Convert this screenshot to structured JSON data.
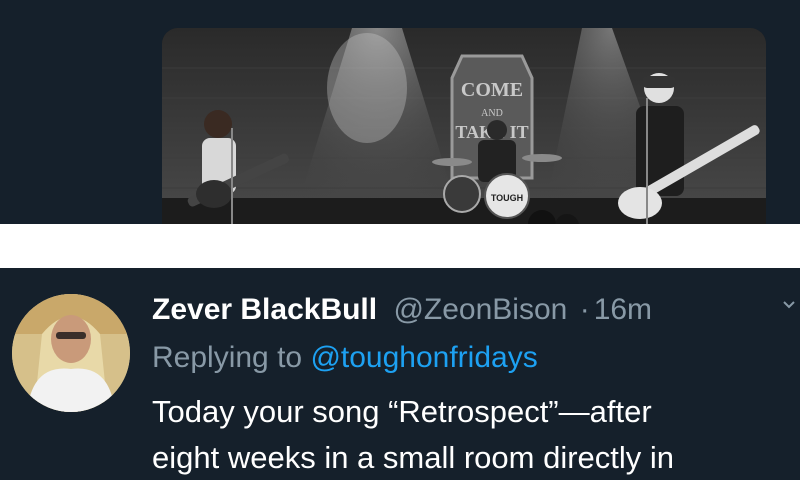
{
  "reply_tweet": {
    "display_name": "Zever BlackBull",
    "handle": "@ZeonBison",
    "separator": "·",
    "time": "16m",
    "replying_prefix": "Replying to",
    "replying_to": "@toughonfridays",
    "text_line_1": "Today your song “Retrospect”—after",
    "text_line_2": "eight weeks in a small room directly in"
  },
  "media": {
    "sign_text_1": "COME",
    "sign_text_2": "AND",
    "sign_text_3": "TAKE IT",
    "drum_text": "TOUGH"
  },
  "icons": {
    "menu": "chevron-down-icon"
  },
  "colors": {
    "background": "#15202b",
    "link": "#1da1f2",
    "muted": "#8899a6",
    "divider": "#ffffff"
  }
}
